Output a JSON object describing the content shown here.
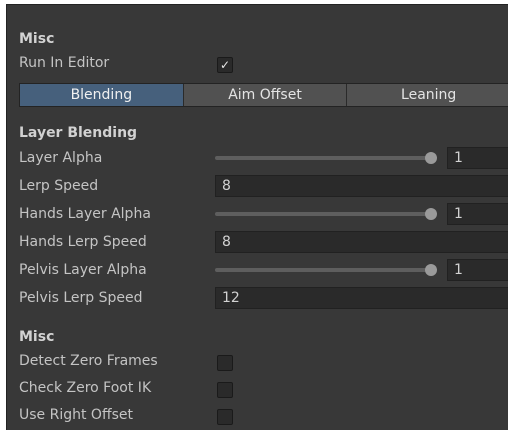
{
  "misc_top": {
    "title": "Misc",
    "run_in_editor": {
      "label": "Run In Editor",
      "checked": true,
      "check_glyph": "✓"
    }
  },
  "tabs": [
    {
      "label": "Blending",
      "active": true
    },
    {
      "label": "Aim Offset",
      "active": false
    },
    {
      "label": "Leaning",
      "active": false
    }
  ],
  "layer_blending": {
    "title": "Layer Blending",
    "layer_alpha": {
      "label": "Layer Alpha",
      "value": "1",
      "level": 1.0
    },
    "lerp_speed": {
      "label": "Lerp Speed",
      "value": "8"
    },
    "hands_layer_alpha": {
      "label": "Hands Layer Alpha",
      "value": "1",
      "level": 1.0
    },
    "hands_lerp_speed": {
      "label": "Hands Lerp Speed",
      "value": "8"
    },
    "pelvis_layer_alpha": {
      "label": "Pelvis Layer Alpha",
      "value": "1",
      "level": 1.0
    },
    "pelvis_lerp_speed": {
      "label": "Pelvis Lerp Speed",
      "value": "12"
    }
  },
  "misc_bottom": {
    "title": "Misc",
    "detect_zero_frames": {
      "label": "Detect Zero Frames",
      "checked": false
    },
    "check_zero_foot_ik": {
      "label": "Check Zero Foot IK",
      "checked": false
    },
    "use_right_offset": {
      "label": "Use Right Offset",
      "checked": false
    }
  },
  "colors": {
    "panel_bg": "#383838",
    "tab_active": "#46607c",
    "tab_inactive": "#515151",
    "field_bg": "#2a2a2a",
    "text": "#c4c4c4"
  }
}
